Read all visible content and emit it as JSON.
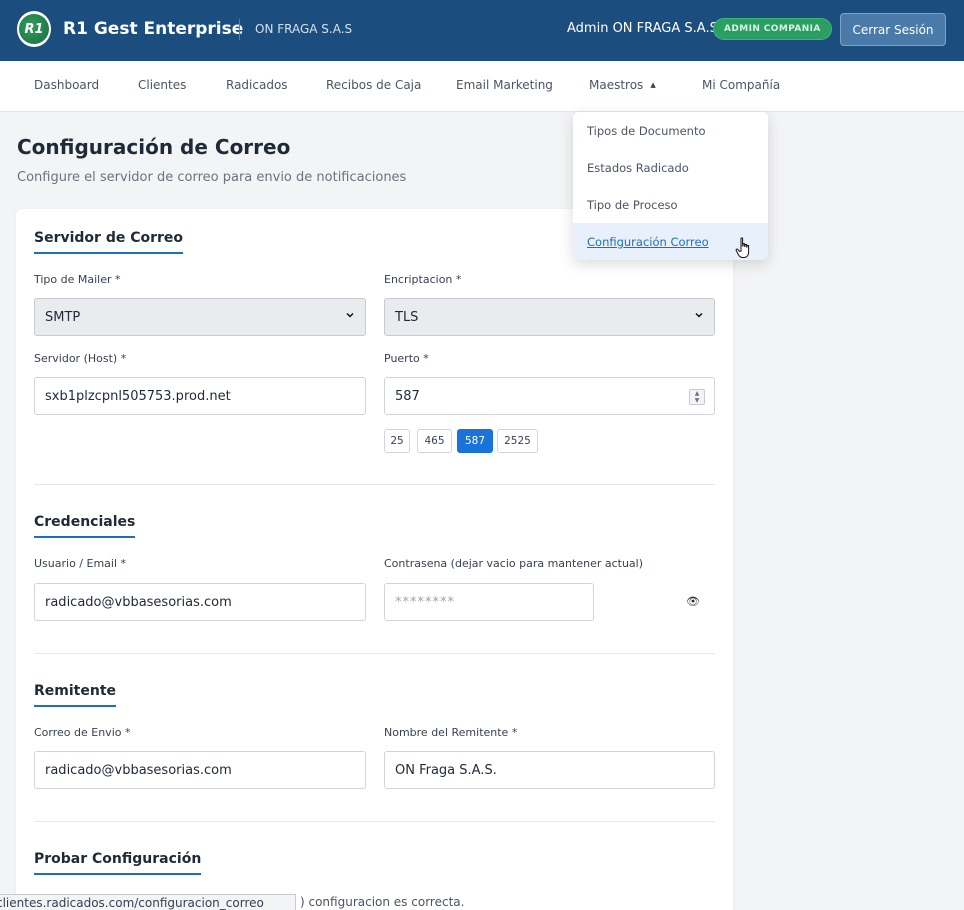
{
  "header": {
    "logo_text": "R1",
    "brand": "R1 Gest Enterprise",
    "company": "ON FRAGA S.A.S",
    "user": "Admin ON FRAGA S.A.S",
    "role_badge": "ADMIN COMPANIA",
    "logout_label": "Cerrar Sesión"
  },
  "nav": {
    "items": [
      "Dashboard",
      "Clientes",
      "Radicados",
      "Recibos de Caja",
      "Email Marketing",
      "Maestros",
      "Mi Compañía"
    ]
  },
  "dropdown": {
    "items": [
      "Tipos de Documento",
      "Estados Radicado",
      "Tipo de Proceso",
      "Configuración Correo"
    ],
    "active_index": 3
  },
  "page": {
    "title": "Configuración de Correo",
    "subtitle": "Configure el servidor de correo para envio de notificaciones"
  },
  "server": {
    "title": "Servidor de Correo",
    "mailer_label": "Tipo de Mailer *",
    "mailer_value": "SMTP",
    "encryption_label": "Encriptacion *",
    "encryption_value": "TLS",
    "host_label": "Servidor (Host) *",
    "host_value": "sxb1plzcpnl505753.prod.net",
    "port_label": "Puerto *",
    "port_value": "587",
    "port_chips": [
      "25",
      "465",
      "587",
      "2525"
    ],
    "active_chip": "587"
  },
  "credentials": {
    "title": "Credenciales",
    "user_label": "Usuario / Email *",
    "user_value": "radicado@vbbasesorias.com",
    "password_label": "Contrasena (dejar vacio para mantener actual)",
    "password_placeholder": "********",
    "eye_icon": "👁"
  },
  "sender": {
    "title": "Remitente",
    "email_label": "Correo de Envio *",
    "email_value": "radicado@vbbasesorias.com",
    "name_label": "Nombre del Remitente *",
    "name_value": "ON Fraga S.A.S."
  },
  "test": {
    "title": "Probar Configuración",
    "text_visible": ") configuracion es correcta."
  },
  "status_bar": {
    "url": "clientes.radicados.com/configuracion_correo"
  }
}
